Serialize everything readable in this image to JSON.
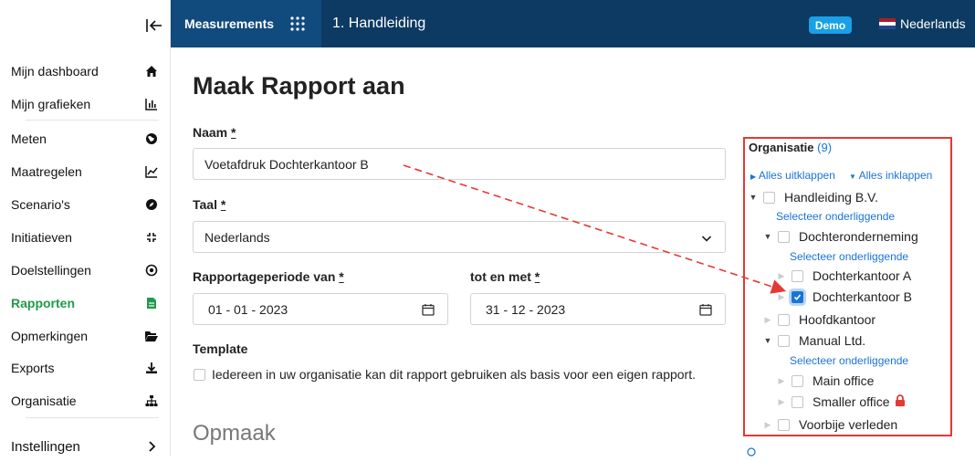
{
  "sidebar": {
    "items": [
      {
        "label": "Mijn dashboard",
        "icon": "home-icon"
      },
      {
        "label": "Mijn grafieken",
        "icon": "bar-chart-icon"
      },
      {
        "label": "Meten",
        "icon": "globe-icon"
      },
      {
        "label": "Maatregelen",
        "icon": "line-chart-icon"
      },
      {
        "label": "Scenario's",
        "icon": "compass-icon"
      },
      {
        "label": "Initiatieven",
        "icon": "collapse-arrows-icon"
      },
      {
        "label": "Doelstellingen",
        "icon": "target-icon"
      },
      {
        "label": "Rapporten",
        "icon": "document-icon"
      },
      {
        "label": "Opmerkingen",
        "icon": "folder-open-icon"
      },
      {
        "label": "Exports",
        "icon": "download-icon"
      },
      {
        "label": "Organisatie",
        "icon": "org-chart-icon"
      },
      {
        "label": "Instellingen",
        "icon": "chevron-right-icon"
      }
    ],
    "active_color": "#1f9a4b"
  },
  "topbar": {
    "section": "Measurements",
    "title": "1. Handleiding",
    "badge": "Demo",
    "language": "Nederlands",
    "bg_color": "#0d3a62",
    "section_bg_color": "#114a7d",
    "badge_color": "#1aa0e6"
  },
  "form": {
    "title": "Maak Rapport aan",
    "name_label": "Naam",
    "required_mark": "*",
    "name_value": "Voetafdruk Dochterkantoor B",
    "language_label": "Taal",
    "language_value": "Nederlands",
    "period_from_label": "Rapportageperiode van",
    "period_from_value": "01 - 01 - 2023",
    "period_to_label": "tot en met",
    "period_to_value": "31 - 12 - 2023",
    "template_label": "Template",
    "template_checkbox_text": "Iedereen in uw organisatie kan dit rapport gebruiken als basis voor een eigen rapport.",
    "layout_heading": "Opmaak"
  },
  "organisation": {
    "title": "Organisatie",
    "count": "(9)",
    "expand_all": "Alles uitklappen",
    "collapse_all": "Alles inklappen",
    "select_children": "Selecteer onderliggende",
    "nodes": [
      {
        "label": "Handleiding B.V.",
        "toggle": "expanded",
        "checked": false
      },
      {
        "label": "Dochteronderneming",
        "toggle": "expanded",
        "checked": false
      },
      {
        "label": "Dochterkantoor A",
        "toggle": "leaf",
        "checked": false
      },
      {
        "label": "Dochterkantoor B",
        "toggle": "leaf",
        "checked": true
      },
      {
        "label": "Hoofdkantoor",
        "toggle": "leaf",
        "checked": false
      },
      {
        "label": "Manual Ltd.",
        "toggle": "expanded",
        "checked": false
      },
      {
        "label": "Main office",
        "toggle": "leaf",
        "checked": false
      },
      {
        "label": "Smaller office",
        "toggle": "leaf",
        "checked": false,
        "locked": true
      },
      {
        "label": "Voorbije verleden",
        "toggle": "leaf",
        "checked": false
      }
    ],
    "highlight_color": "#e53935",
    "link_color": "#1a73d9"
  }
}
